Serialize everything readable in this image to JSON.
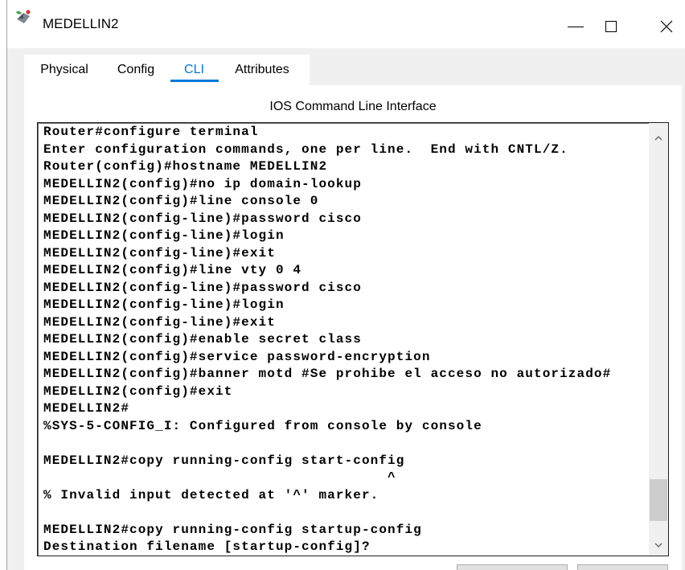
{
  "window": {
    "title": "MEDELLIN2",
    "app_icon": "app-icon",
    "controls": [
      "minimize-icon",
      "maximize-icon",
      "close-icon"
    ]
  },
  "tabs": [
    {
      "label": "Physical",
      "active": false
    },
    {
      "label": "Config",
      "active": false
    },
    {
      "label": "CLI",
      "active": true
    },
    {
      "label": "Attributes",
      "active": false
    }
  ],
  "cli": {
    "heading": "IOS Command Line Interface",
    "lines": [
      "Router#configure terminal",
      "Enter configuration commands, one per line.  End with CNTL/Z.",
      "Router(config)#hostname MEDELLIN2",
      "MEDELLIN2(config)#no ip domain-lookup",
      "MEDELLIN2(config)#line console 0",
      "MEDELLIN2(config-line)#password cisco",
      "MEDELLIN2(config-line)#login",
      "MEDELLIN2(config-line)#exit",
      "MEDELLIN2(config)#line vty 0 4",
      "MEDELLIN2(config-line)#password cisco",
      "MEDELLIN2(config-line)#login",
      "MEDELLIN2(config-line)#exit",
      "MEDELLIN2(config)#enable secret class",
      "MEDELLIN2(config)#service password-encryption",
      "MEDELLIN2(config)#banner motd #Se prohibe el acceso no autorizado#",
      "MEDELLIN2(config)#exit",
      "MEDELLIN2#",
      "%SYS-5-CONFIG_I: Configured from console by console",
      "",
      "MEDELLIN2#copy running-config start-config",
      "                                        ^",
      "% Invalid input detected at '^' marker.",
      "",
      "MEDELLIN2#copy running-config startup-config",
      "Destination filename [startup-config]?"
    ],
    "scrollbar": {
      "scrolled_percent": 96,
      "visible_percent": 11,
      "up_icon": "chevron-up-icon",
      "down_icon": "chevron-down-icon"
    }
  },
  "colors": {
    "accent": "#0078d7",
    "window_bg": "#f0f0f0",
    "pane_bg": "#ffffff",
    "terminal_text": "#000000",
    "scrollbar_thumb": "#cdcdcd"
  }
}
